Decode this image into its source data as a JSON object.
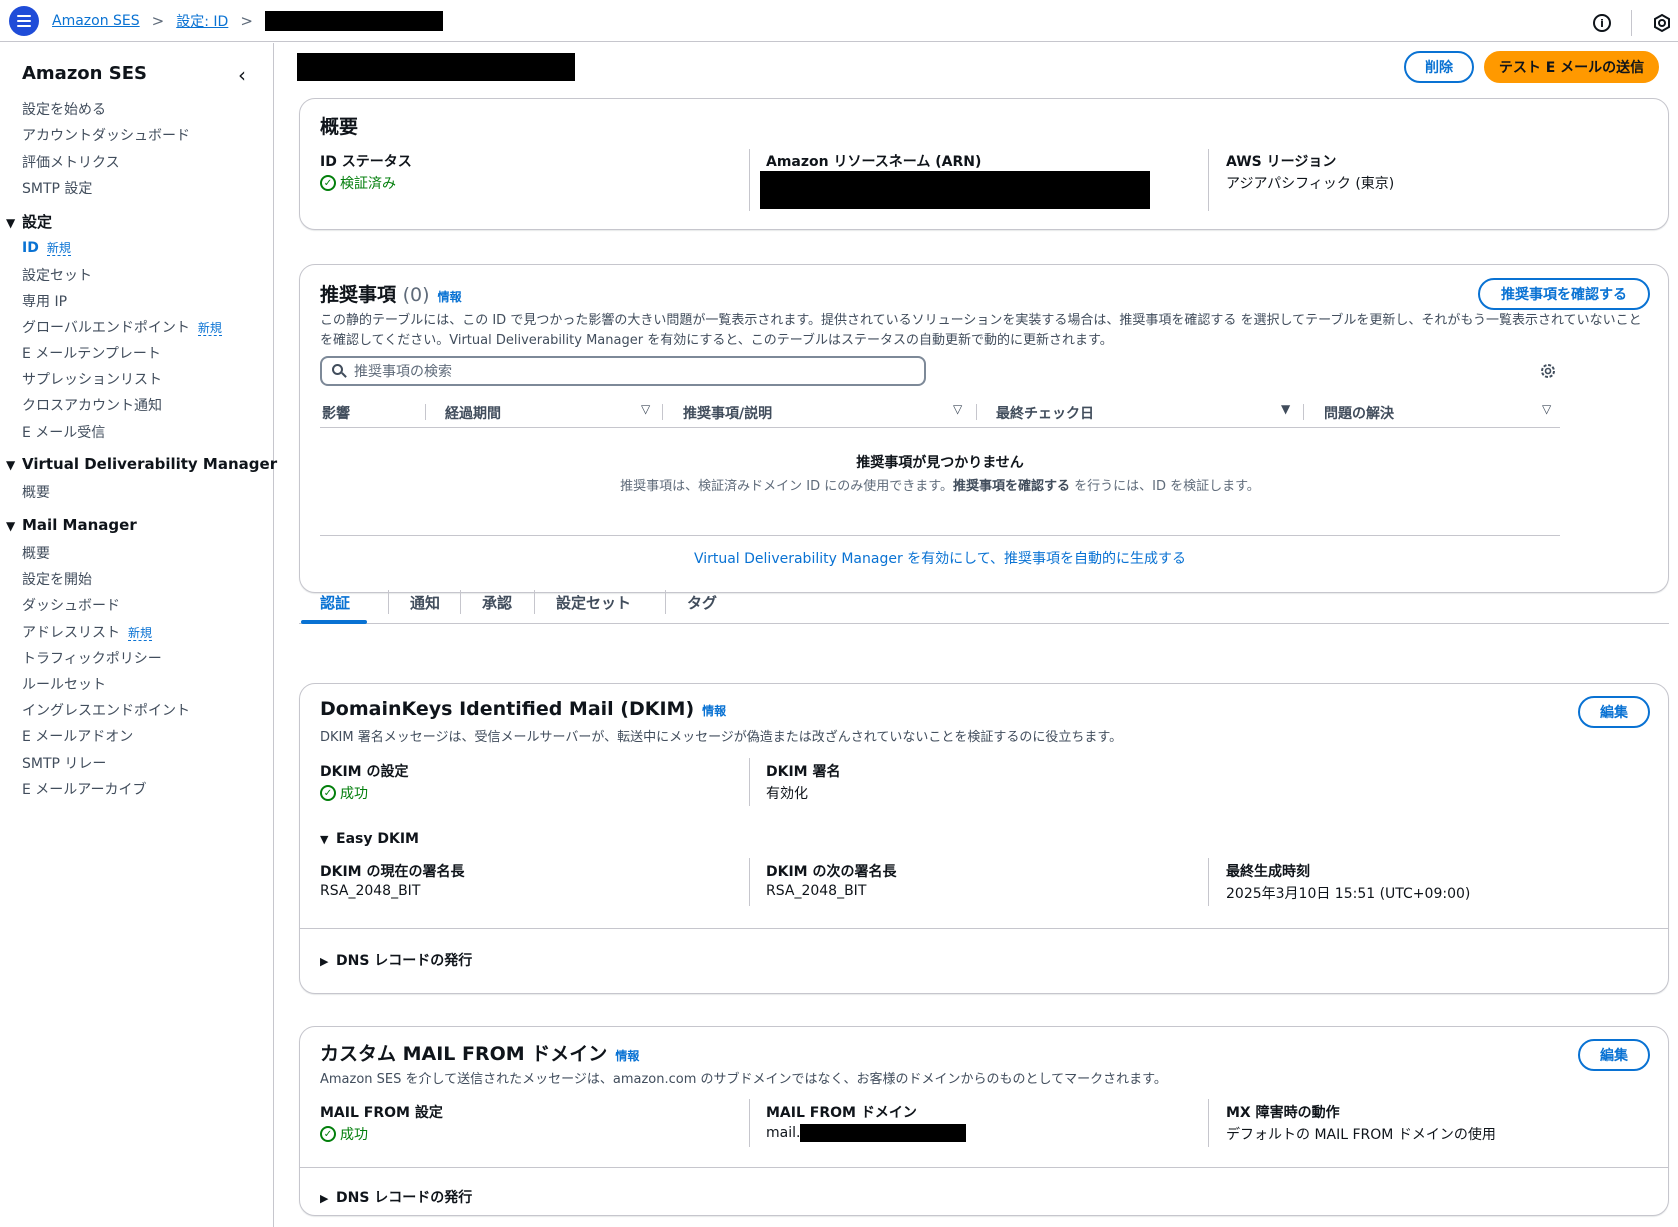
{
  "breadcrumb": {
    "home": "Amazon SES",
    "section": "設定: ID"
  },
  "sidebar": {
    "title": "Amazon SES",
    "items_top": [
      "設定を始める",
      "アカウントダッシュボード",
      "評価メトリクス",
      "SMTP 設定"
    ],
    "group_settings": "設定",
    "settings_items": [
      {
        "label": "ID",
        "badge": "新規"
      },
      {
        "label": "設定セット",
        "badge": ""
      },
      {
        "label": "専用 IP",
        "badge": ""
      },
      {
        "label": "グローバルエンドポイント",
        "badge": "新規"
      },
      {
        "label": "E メールテンプレート",
        "badge": ""
      },
      {
        "label": "サプレッションリスト",
        "badge": ""
      },
      {
        "label": "クロスアカウント通知",
        "badge": ""
      },
      {
        "label": "E メール受信",
        "badge": ""
      }
    ],
    "group_vdm": "Virtual Deliverability Manager",
    "vdm_items": [
      "概要"
    ],
    "group_mail": "Mail Manager",
    "mail_items": [
      {
        "label": "概要",
        "badge": ""
      },
      {
        "label": "設定を開始",
        "badge": ""
      },
      {
        "label": "ダッシュボード",
        "badge": ""
      },
      {
        "label": "アドレスリスト",
        "badge": "新規"
      },
      {
        "label": "トラフィックポリシー",
        "badge": ""
      },
      {
        "label": "ルールセット",
        "badge": ""
      },
      {
        "label": "イングレスエンドポイント",
        "badge": ""
      },
      {
        "label": "E メールアドオン",
        "badge": ""
      },
      {
        "label": "SMTP リレー",
        "badge": ""
      },
      {
        "label": "E メールアーカイブ",
        "badge": ""
      }
    ]
  },
  "header": {
    "delete_label": "削除",
    "send_test_label": "テスト E メールの送信"
  },
  "overview": {
    "title": "概要",
    "id_status_label": "ID ステータス",
    "id_status_value": "検証済み",
    "arn_label": "Amazon リソースネーム (ARN)",
    "region_label": "AWS リージョン",
    "region_value": "アジアパシフィック (東京)"
  },
  "recommendations": {
    "title": "推奨事項",
    "count": "(0)",
    "info": "情報",
    "view_button": "推奨事項を確認する",
    "description": "この静的テーブルには、この ID で見つかった影響の大きい問題が一覧表示されます。提供されているソリューションを実装する場合は、推奨事項を確認する を選択してテーブルを更新し、それがもう一覧表示されていないことを確認してください。Virtual Deliverability Manager を有効にすると、このテーブルはステータスの自動更新で動的に更新されます。",
    "search_placeholder": "推奨事項の検索",
    "columns": [
      "影響",
      "経過期間",
      "推奨事項/説明",
      "最終チェック日",
      "問題の解決"
    ],
    "empty_title": "推奨事項が見つかりません",
    "empty_sub_1": "推奨事項は、検証済みドメイン ID にのみ使用できます。",
    "empty_sub_bold": "推奨事項を確認する",
    "empty_sub_2": " を行うには、ID を検証します。",
    "vdm_link": "Virtual Deliverability Manager を有効にして、推奨事項を自動的に生成する"
  },
  "tabs": [
    "認証",
    "通知",
    "承認",
    "設定セット",
    "タグ"
  ],
  "dkim": {
    "title": "DomainKeys Identified Mail (DKIM)",
    "info": "情報",
    "edit": "編集",
    "description": "DKIM 署名メッセージは、受信メールサーバーが、転送中にメッセージが偽造または改ざんされていないことを検証するのに役立ちます。",
    "config_label": "DKIM の設定",
    "config_value": "成功",
    "signing_label": "DKIM 署名",
    "signing_value": "有効化",
    "easy_dkim": "Easy DKIM",
    "current_len_label": "DKIM の現在の署名長",
    "current_len_value": "RSA_2048_BIT",
    "next_len_label": "DKIM の次の署名長",
    "next_len_value": "RSA_2048_BIT",
    "last_gen_label": "最終生成時刻",
    "last_gen_value": "2025年3月10日 15:51 (UTC+09:00)",
    "dns_records": "DNS レコードの発行"
  },
  "mailfrom": {
    "title": "カスタム MAIL FROM ドメイン",
    "info": "情報",
    "edit": "編集",
    "description": "Amazon SES を介して送信されたメッセージは、amazon.com のサブドメインではなく、お客様のドメインからのものとしてマークされます。",
    "setting_label": "MAIL FROM 設定",
    "setting_value": "成功",
    "domain_label": "MAIL FROM ドメイン",
    "domain_prefix": "mail.",
    "mx_label": "MX 障害時の動作",
    "mx_value": "デフォルトの MAIL FROM ドメインの使用",
    "dns_records": "DNS レコードの発行"
  },
  "colors": {
    "accent": "#0972d3",
    "primary_button": "#ff9900",
    "success": "#037f0c",
    "menu_button": "#1f4cd8"
  }
}
